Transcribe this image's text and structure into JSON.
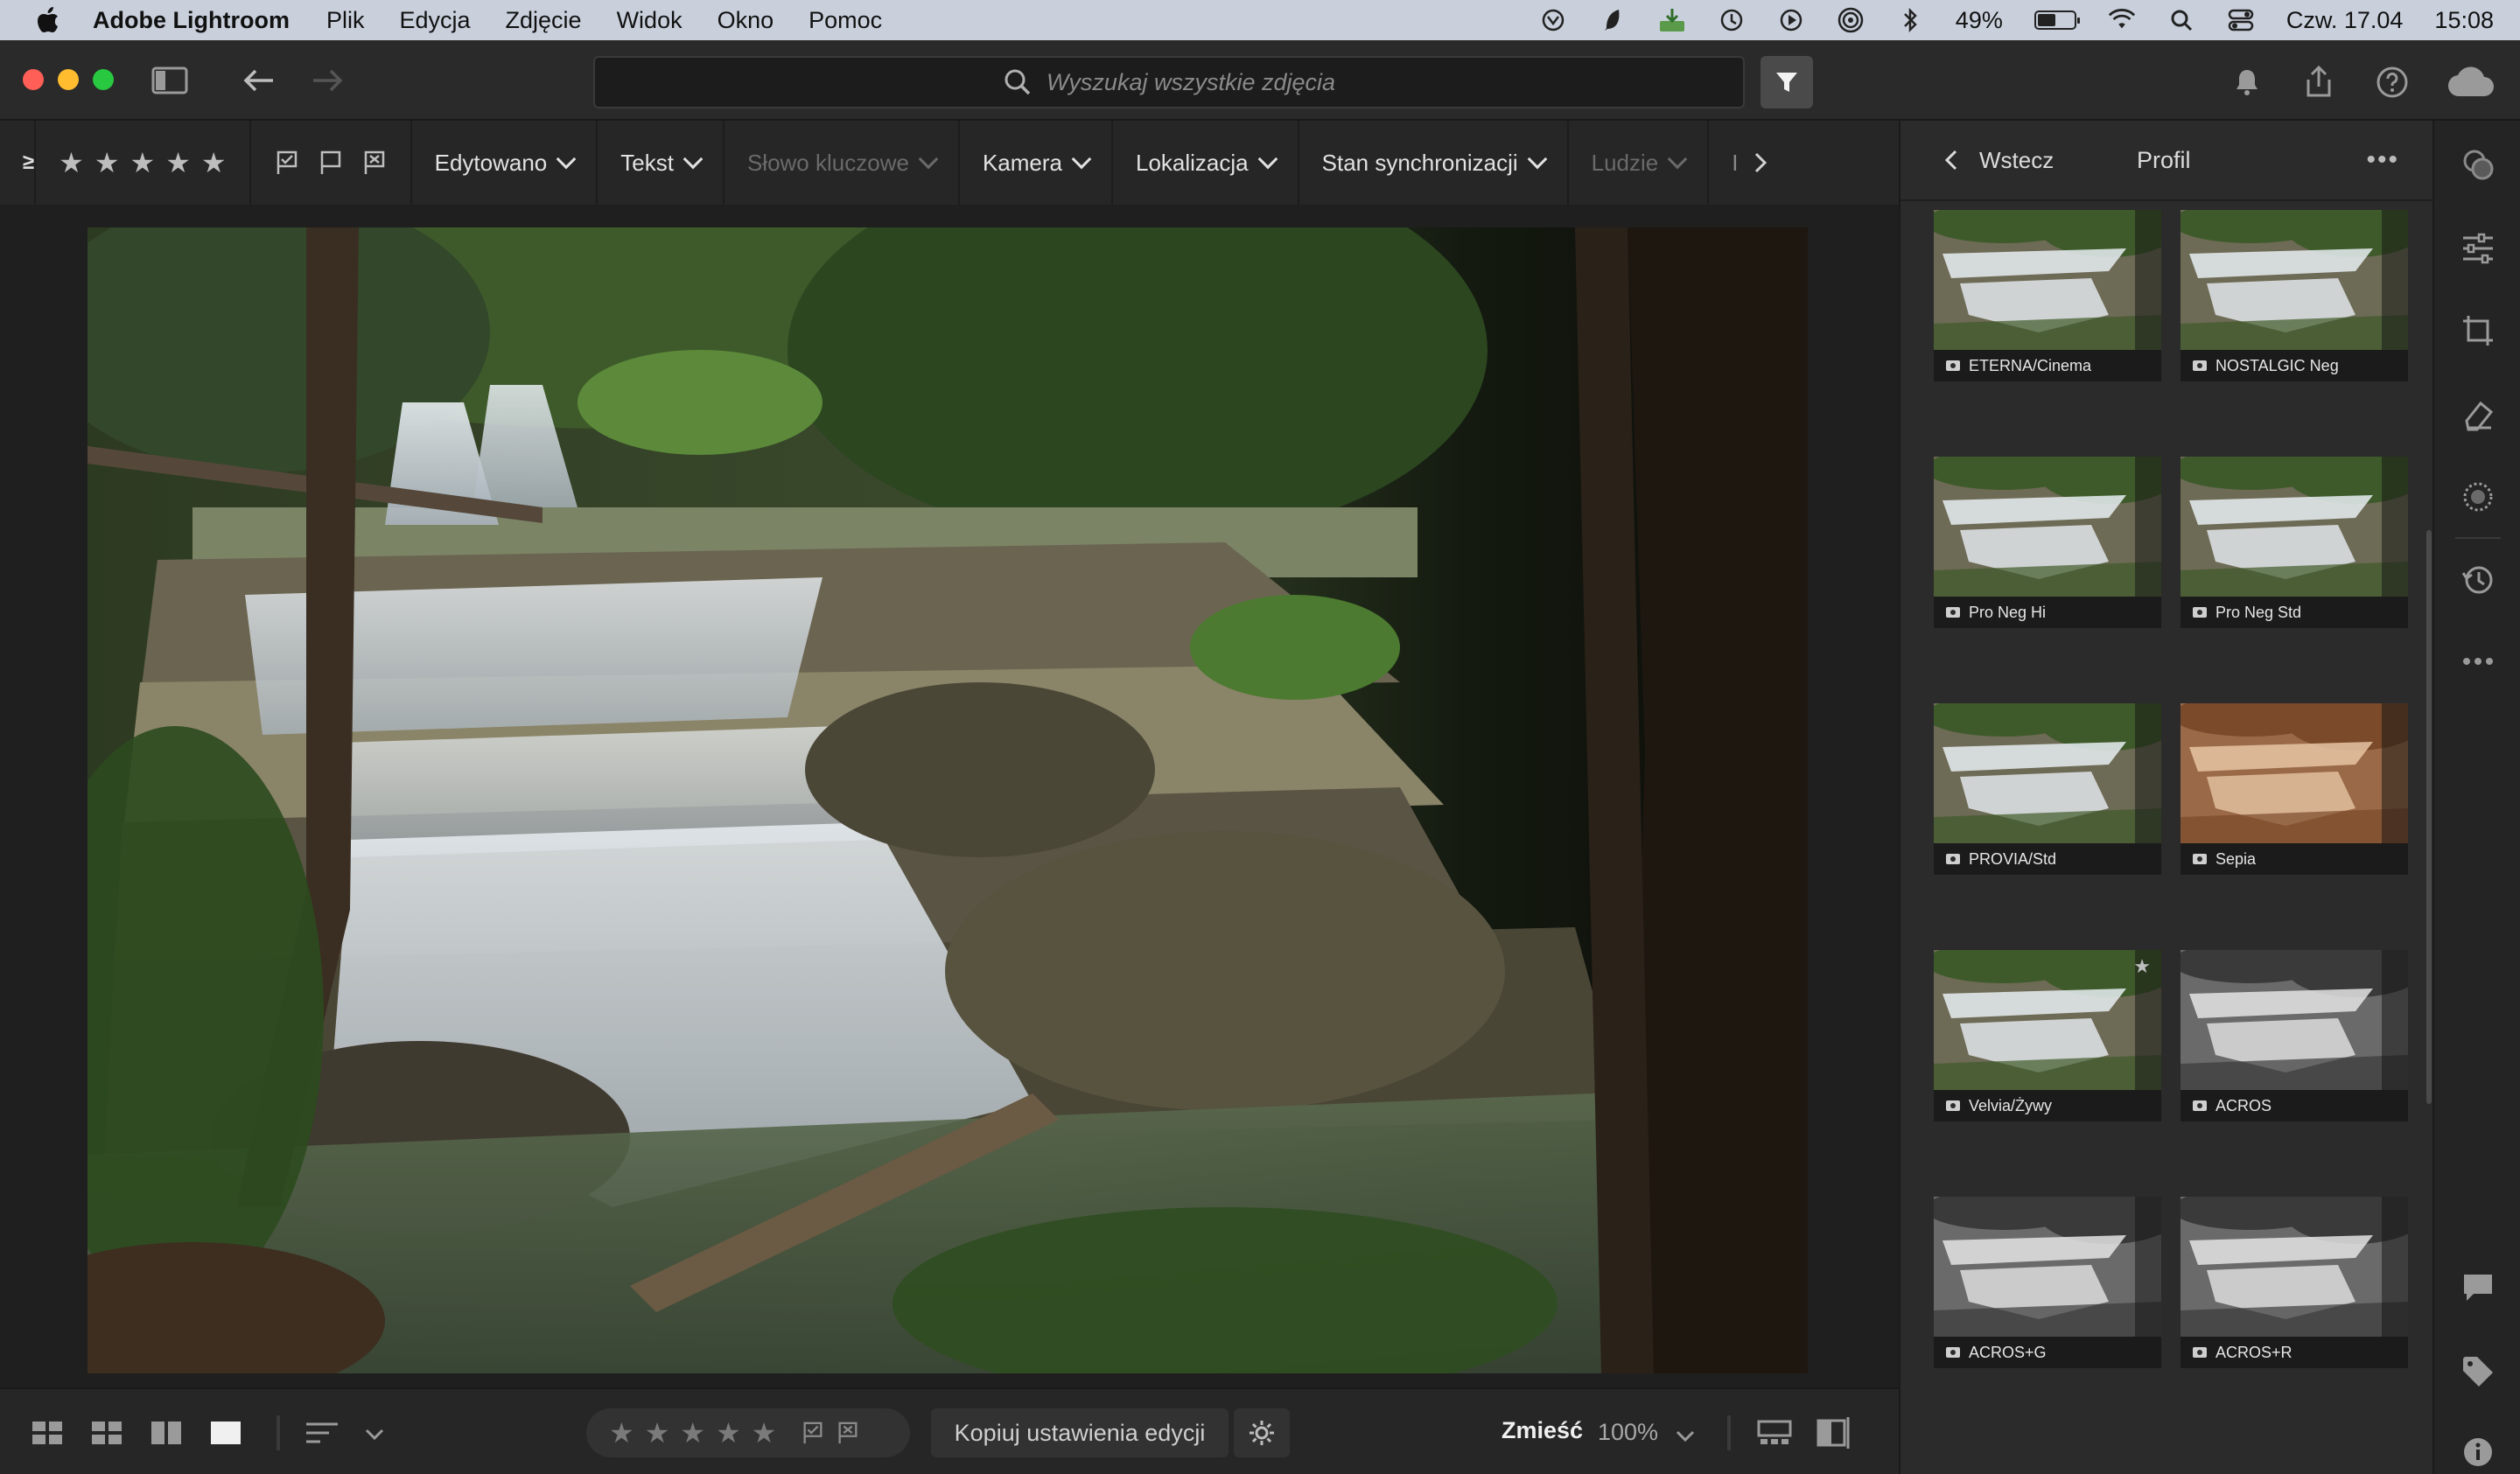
{
  "menubar": {
    "app_name": "Adobe Lightroom",
    "items": [
      "Plik",
      "Edycja",
      "Zdjęcie",
      "Widok",
      "Okno",
      "Pomoc"
    ],
    "battery": "49%",
    "datetime": "Czw. 17.04",
    "time": "15:08"
  },
  "toolbar": {
    "search_placeholder": "Wyszukaj wszystkie zdjęcia"
  },
  "filterbar": {
    "scope": "≥",
    "filters": [
      {
        "label": "Edytowano",
        "enabled": true
      },
      {
        "label": "Tekst",
        "enabled": true
      },
      {
        "label": "Słowo kluczowe",
        "enabled": false
      },
      {
        "label": "Kamera",
        "enabled": true
      },
      {
        "label": "Lokalizacja",
        "enabled": true
      },
      {
        "label": "Stan synchronizacji",
        "enabled": true
      },
      {
        "label": "Ludzie",
        "enabled": false
      }
    ],
    "more": "I"
  },
  "bottombar": {
    "copy_settings": "Kopiuj ustawienia edycji",
    "fit_label": "Zmieść",
    "zoom": "100%"
  },
  "panel": {
    "back_label": "Wstecz",
    "title": "Profil",
    "profiles": [
      {
        "name": "ETERNA/Cinema",
        "style": "color"
      },
      {
        "name": "NOSTALGIC Neg",
        "style": "color"
      },
      {
        "name": "Pro Neg Hi",
        "style": "color"
      },
      {
        "name": "Pro Neg Std",
        "style": "color"
      },
      {
        "name": "PROVIA/Std",
        "style": "color"
      },
      {
        "name": "Sepia",
        "style": "sepia"
      },
      {
        "name": "Velvia/Żywy",
        "style": "color",
        "favorite": true
      },
      {
        "name": "ACROS",
        "style": "bw"
      },
      {
        "name": "ACROS+G",
        "style": "bw"
      },
      {
        "name": "ACROS+R",
        "style": "bw"
      }
    ]
  },
  "colors": {
    "accent": "#e8e8e8",
    "panel_bg": "#2b2b2b",
    "menubar_bg": "#c9d0dc"
  }
}
